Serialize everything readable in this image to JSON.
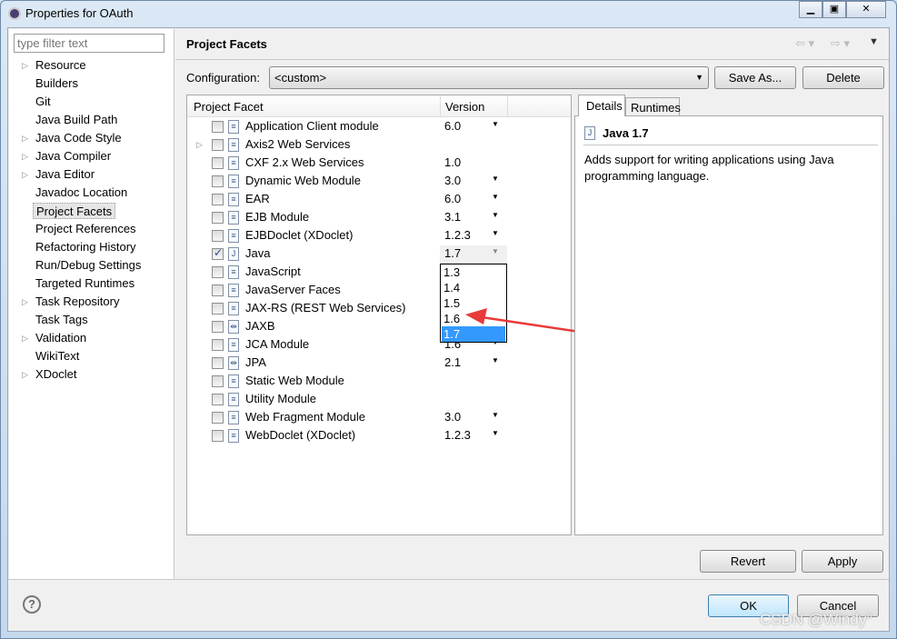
{
  "window": {
    "title": "Properties for OAuth",
    "controls": [
      "minimize",
      "maximize",
      "close"
    ]
  },
  "sidebar": {
    "filter_placeholder": "type filter text",
    "items": [
      {
        "label": "Resource",
        "expandable": true
      },
      {
        "label": "Builders"
      },
      {
        "label": "Git"
      },
      {
        "label": "Java Build Path"
      },
      {
        "label": "Java Code Style",
        "expandable": true
      },
      {
        "label": "Java Compiler",
        "expandable": true
      },
      {
        "label": "Java Editor",
        "expandable": true
      },
      {
        "label": "Javadoc Location"
      },
      {
        "label": "Project Facets",
        "selected": true
      },
      {
        "label": "Project References"
      },
      {
        "label": "Refactoring History"
      },
      {
        "label": "Run/Debug Settings"
      },
      {
        "label": "Targeted Runtimes"
      },
      {
        "label": "Task Repository",
        "expandable": true
      },
      {
        "label": "Task Tags"
      },
      {
        "label": "Validation",
        "expandable": true
      },
      {
        "label": "WikiText"
      },
      {
        "label": "XDoclet",
        "expandable": true
      }
    ]
  },
  "header": {
    "title": "Project Facets"
  },
  "config": {
    "label": "Configuration:",
    "value": "<custom>",
    "save_as": "Save As...",
    "delete": "Delete"
  },
  "table": {
    "col_facet": "Project Facet",
    "col_version": "Version",
    "rows": [
      {
        "name": "Application Client module",
        "version": "6.0",
        "dropdown": true
      },
      {
        "name": "Axis2 Web Services",
        "version": "",
        "expandable": true
      },
      {
        "name": "CXF 2.x Web Services",
        "version": "1.0"
      },
      {
        "name": "Dynamic Web Module",
        "version": "3.0",
        "dropdown": true
      },
      {
        "name": "EAR",
        "version": "6.0",
        "dropdown": true
      },
      {
        "name": "EJB Module",
        "version": "3.1",
        "dropdown": true
      },
      {
        "name": "EJBDoclet (XDoclet)",
        "version": "1.2.3",
        "dropdown": true
      },
      {
        "name": "Java",
        "version": "1.7",
        "dropdown": true,
        "checked": true
      },
      {
        "name": "JavaScript",
        "version": ""
      },
      {
        "name": "JavaServer Faces",
        "version": ""
      },
      {
        "name": "JAX-RS (REST Web Services)",
        "version": ""
      },
      {
        "name": "JAXB",
        "version": ""
      },
      {
        "name": "JCA Module",
        "version": "1.6",
        "dropdown": true
      },
      {
        "name": "JPA",
        "version": "2.1",
        "dropdown": true
      },
      {
        "name": "Static Web Module",
        "version": ""
      },
      {
        "name": "Utility Module",
        "version": ""
      },
      {
        "name": "Web Fragment Module",
        "version": "3.0",
        "dropdown": true
      },
      {
        "name": "WebDoclet (XDoclet)",
        "version": "1.2.3",
        "dropdown": true
      }
    ]
  },
  "version_dropdown": {
    "options": [
      "1.3",
      "1.4",
      "1.5",
      "1.6",
      "1.7"
    ],
    "selected": "1.7"
  },
  "details": {
    "tabs": [
      "Details",
      "Runtimes"
    ],
    "active_tab": "Details",
    "heading": "Java 1.7",
    "description": "Adds support for writing applications using Java programming language."
  },
  "buttons": {
    "revert": "Revert",
    "apply": "Apply",
    "ok": "OK",
    "cancel": "Cancel"
  },
  "watermark": "CSDN @Windy°",
  "colors": {
    "selection": "#3399ff",
    "annotation_arrow": "#e83a3a"
  }
}
